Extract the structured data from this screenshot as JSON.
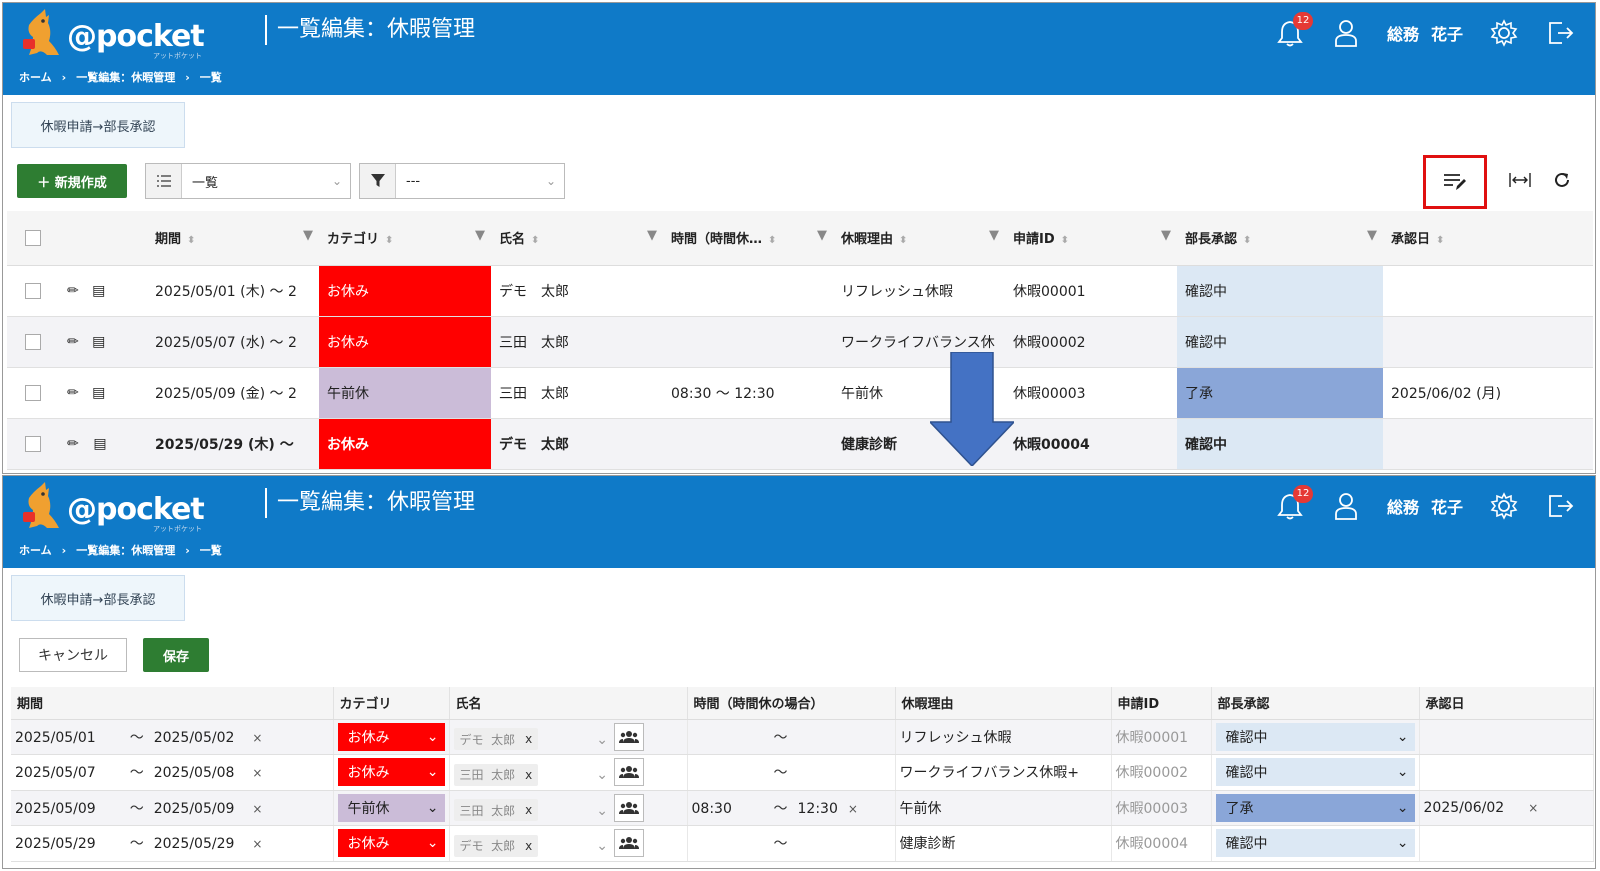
{
  "header": {
    "logo_text": "@pocket",
    "logo_kana": "アットポケット",
    "title": "一覧編集：休暇管理",
    "breadcrumb": [
      "ホーム",
      "›",
      "一覧編集：休暇管理",
      "›",
      "一覧"
    ],
    "notification_count": "12",
    "user_dept": "総務",
    "user_name": "花子",
    "icons": [
      "bell-icon",
      "user-icon",
      "gear-icon",
      "logout-icon"
    ]
  },
  "tab_button": "休暇申請→部長承認",
  "view": {
    "new_button": "＋ 新規作成",
    "view_select": "一覧",
    "filter_select": "---",
    "right_icons": [
      "list-edit-icon",
      "column-fit-icon",
      "refresh-icon"
    ]
  },
  "table_view": {
    "columns": [
      "期間",
      "カテゴリ",
      "氏名",
      "時間（時間休…",
      "休暇理由",
      "申請ID",
      "部長承認",
      "承認日"
    ],
    "rows": [
      {
        "period": "2025/05/01 (木) ～ 2",
        "category": "お休み",
        "name": "デモ　太郎",
        "time": "",
        "reason": "リフレッシュ休暇",
        "id": "休暇00001",
        "approval": "確認中",
        "date": ""
      },
      {
        "period": "2025/05/07 (水) ～ 2",
        "category": "お休み",
        "name": "三田　太郎",
        "time": "",
        "reason": "ワークライフバランス休",
        "id": "休暇00002",
        "approval": "確認中",
        "date": ""
      },
      {
        "period": "2025/05/09 (金) ～ 2",
        "category": "午前休",
        "name": "三田　太郎",
        "time": "08:30 ～ 12:30",
        "reason": "午前休",
        "id": "休暇00003",
        "approval": "了承",
        "date": "2025/06/02 (月)"
      },
      {
        "period": "2025/05/29 (木) ～",
        "category": "お休み",
        "name": "デモ　太郎",
        "time": "",
        "reason": "健康診断",
        "id": "休暇00004",
        "approval": "確認中",
        "date": ""
      }
    ]
  },
  "edit": {
    "cancel_button": "キャンセル",
    "save_button": "保存",
    "columns": [
      "期間",
      "カテゴリ",
      "氏名",
      "時間（時間休の場合）",
      "休暇理由",
      "申請ID",
      "部長承認",
      "承認日"
    ],
    "rows": [
      {
        "start": "2025/05/01",
        "end": "2025/05/02",
        "category": "お休み",
        "name_family": "デモ",
        "name_given": "太郎",
        "time_start": "",
        "time_end": "",
        "reason": "リフレッシュ休暇",
        "id": "休暇00001",
        "approval": "確認中",
        "date": ""
      },
      {
        "start": "2025/05/07",
        "end": "2025/05/08",
        "category": "お休み",
        "name_family": "三田",
        "name_given": "太郎",
        "time_start": "",
        "time_end": "",
        "reason": "ワークライフバランス休暇+",
        "id": "休暇00002",
        "approval": "確認中",
        "date": ""
      },
      {
        "start": "2025/05/09",
        "end": "2025/05/09",
        "category": "午前休",
        "name_family": "三田",
        "name_given": "太郎",
        "time_start": "08:30",
        "time_end": "12:30",
        "reason": "午前休",
        "id": "休暇00003",
        "approval": "了承",
        "date": "2025/06/02"
      },
      {
        "start": "2025/05/29",
        "end": "2025/05/29",
        "category": "お休み",
        "name_family": "デモ",
        "name_given": "太郎",
        "time_start": "",
        "time_end": "",
        "reason": "健康診断",
        "id": "休暇00004",
        "approval": "確認中",
        "date": ""
      }
    ]
  },
  "symbols": {
    "tilde": "～",
    "clear": "×",
    "chip_remove": "x",
    "caret": "⌄"
  },
  "colors": {
    "header_blue": "#0f7ac8",
    "category_red": "#ff0000",
    "category_lavender": "#cbbcd8",
    "approval_light": "#dce8f4",
    "approval_accepted": "#8aa6d8",
    "highlight_red": "#e01010",
    "arrow_blue": "#4472c4",
    "save_green": "#2e7d32"
  }
}
